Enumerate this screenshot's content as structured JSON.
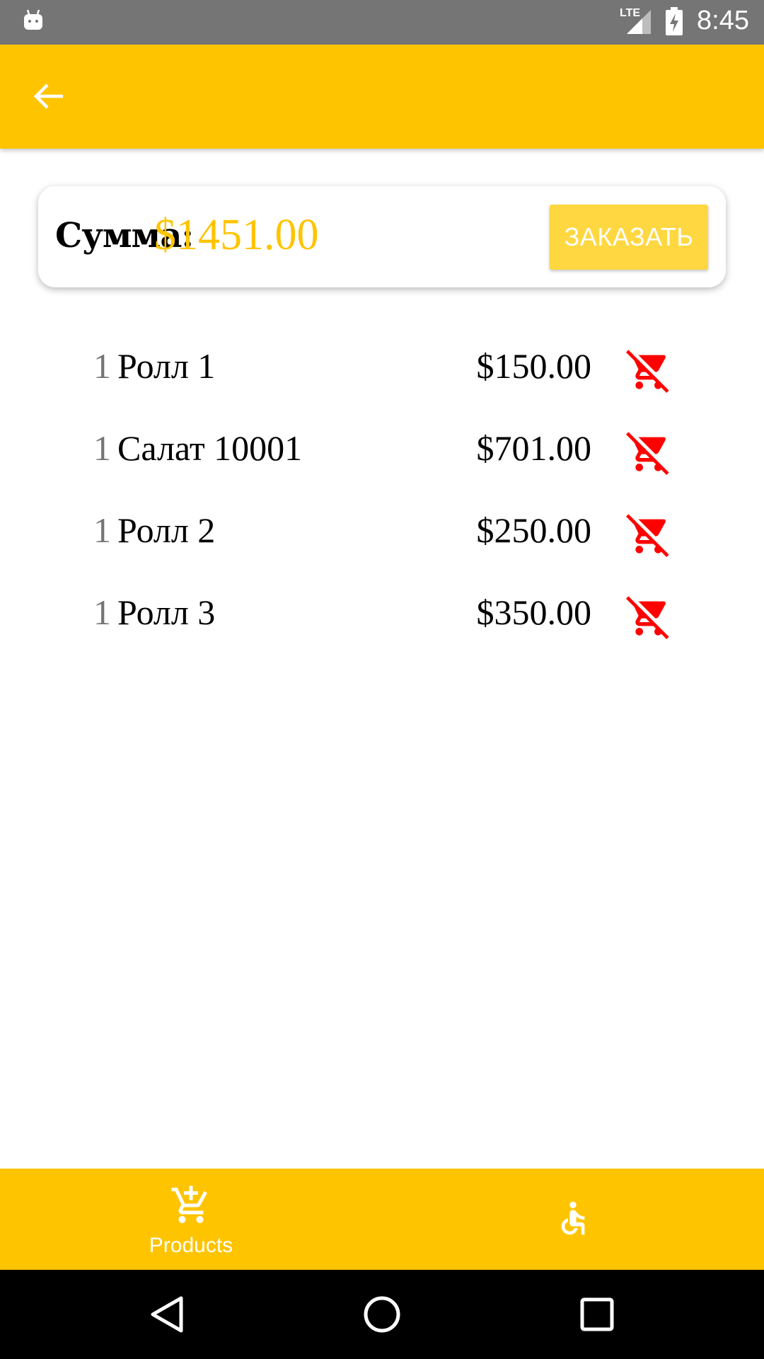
{
  "status_bar": {
    "network": "LTE",
    "time": "8:45",
    "icons": [
      "android-icon",
      "signal-icon",
      "battery-charging-icon"
    ]
  },
  "app_bar": {
    "back_icon": "arrow-back-icon"
  },
  "summary": {
    "label": "Сумма:",
    "total": "$1451.00",
    "order_button_label": "ЗАКАЗАТЬ"
  },
  "items": [
    {
      "qty": "1",
      "name": "Ролл 1",
      "price": "$150.00",
      "remove_icon": "remove-shopping-cart-icon"
    },
    {
      "qty": "1",
      "name": "Салат 10001",
      "price": "$701.00",
      "remove_icon": "remove-shopping-cart-icon"
    },
    {
      "qty": "1",
      "name": "Ролл 2",
      "price": "$250.00",
      "remove_icon": "remove-shopping-cart-icon"
    },
    {
      "qty": "1",
      "name": "Ролл 3",
      "price": "$350.00",
      "remove_icon": "remove-shopping-cart-icon"
    }
  ],
  "bottom_nav": {
    "products_label": "Products",
    "products_icon": "add-shopping-cart-icon",
    "second_icon": "accessible-icon"
  },
  "system_nav": {
    "icons": [
      "back-triangle-icon",
      "home-circle-icon",
      "recents-square-icon"
    ]
  },
  "colors": {
    "accent": "#FFC400",
    "button": "#FFD740",
    "remove_icon": "#FF0000",
    "status_bar": "#757575",
    "quantity_text": "#757575"
  }
}
